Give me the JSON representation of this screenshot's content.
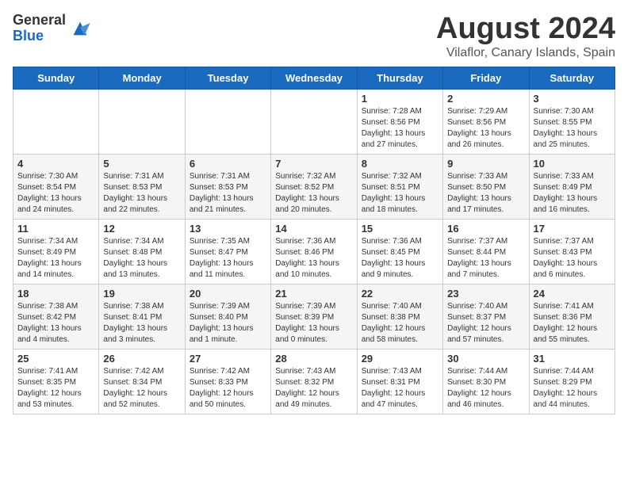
{
  "header": {
    "logo_line1": "General",
    "logo_line2": "Blue",
    "month_title": "August 2024",
    "location": "Vilaflor, Canary Islands, Spain"
  },
  "days_of_week": [
    "Sunday",
    "Monday",
    "Tuesday",
    "Wednesday",
    "Thursday",
    "Friday",
    "Saturday"
  ],
  "weeks": [
    [
      {
        "day": "",
        "info": ""
      },
      {
        "day": "",
        "info": ""
      },
      {
        "day": "",
        "info": ""
      },
      {
        "day": "",
        "info": ""
      },
      {
        "day": "1",
        "info": "Sunrise: 7:28 AM\nSunset: 8:56 PM\nDaylight: 13 hours and 27 minutes."
      },
      {
        "day": "2",
        "info": "Sunrise: 7:29 AM\nSunset: 8:56 PM\nDaylight: 13 hours and 26 minutes."
      },
      {
        "day": "3",
        "info": "Sunrise: 7:30 AM\nSunset: 8:55 PM\nDaylight: 13 hours and 25 minutes."
      }
    ],
    [
      {
        "day": "4",
        "info": "Sunrise: 7:30 AM\nSunset: 8:54 PM\nDaylight: 13 hours and 24 minutes."
      },
      {
        "day": "5",
        "info": "Sunrise: 7:31 AM\nSunset: 8:53 PM\nDaylight: 13 hours and 22 minutes."
      },
      {
        "day": "6",
        "info": "Sunrise: 7:31 AM\nSunset: 8:53 PM\nDaylight: 13 hours and 21 minutes."
      },
      {
        "day": "7",
        "info": "Sunrise: 7:32 AM\nSunset: 8:52 PM\nDaylight: 13 hours and 20 minutes."
      },
      {
        "day": "8",
        "info": "Sunrise: 7:32 AM\nSunset: 8:51 PM\nDaylight: 13 hours and 18 minutes."
      },
      {
        "day": "9",
        "info": "Sunrise: 7:33 AM\nSunset: 8:50 PM\nDaylight: 13 hours and 17 minutes."
      },
      {
        "day": "10",
        "info": "Sunrise: 7:33 AM\nSunset: 8:49 PM\nDaylight: 13 hours and 16 minutes."
      }
    ],
    [
      {
        "day": "11",
        "info": "Sunrise: 7:34 AM\nSunset: 8:49 PM\nDaylight: 13 hours and 14 minutes."
      },
      {
        "day": "12",
        "info": "Sunrise: 7:34 AM\nSunset: 8:48 PM\nDaylight: 13 hours and 13 minutes."
      },
      {
        "day": "13",
        "info": "Sunrise: 7:35 AM\nSunset: 8:47 PM\nDaylight: 13 hours and 11 minutes."
      },
      {
        "day": "14",
        "info": "Sunrise: 7:36 AM\nSunset: 8:46 PM\nDaylight: 13 hours and 10 minutes."
      },
      {
        "day": "15",
        "info": "Sunrise: 7:36 AM\nSunset: 8:45 PM\nDaylight: 13 hours and 9 minutes."
      },
      {
        "day": "16",
        "info": "Sunrise: 7:37 AM\nSunset: 8:44 PM\nDaylight: 13 hours and 7 minutes."
      },
      {
        "day": "17",
        "info": "Sunrise: 7:37 AM\nSunset: 8:43 PM\nDaylight: 13 hours and 6 minutes."
      }
    ],
    [
      {
        "day": "18",
        "info": "Sunrise: 7:38 AM\nSunset: 8:42 PM\nDaylight: 13 hours and 4 minutes."
      },
      {
        "day": "19",
        "info": "Sunrise: 7:38 AM\nSunset: 8:41 PM\nDaylight: 13 hours and 3 minutes."
      },
      {
        "day": "20",
        "info": "Sunrise: 7:39 AM\nSunset: 8:40 PM\nDaylight: 13 hours and 1 minute."
      },
      {
        "day": "21",
        "info": "Sunrise: 7:39 AM\nSunset: 8:39 PM\nDaylight: 13 hours and 0 minutes."
      },
      {
        "day": "22",
        "info": "Sunrise: 7:40 AM\nSunset: 8:38 PM\nDaylight: 12 hours and 58 minutes."
      },
      {
        "day": "23",
        "info": "Sunrise: 7:40 AM\nSunset: 8:37 PM\nDaylight: 12 hours and 57 minutes."
      },
      {
        "day": "24",
        "info": "Sunrise: 7:41 AM\nSunset: 8:36 PM\nDaylight: 12 hours and 55 minutes."
      }
    ],
    [
      {
        "day": "25",
        "info": "Sunrise: 7:41 AM\nSunset: 8:35 PM\nDaylight: 12 hours and 53 minutes."
      },
      {
        "day": "26",
        "info": "Sunrise: 7:42 AM\nSunset: 8:34 PM\nDaylight: 12 hours and 52 minutes."
      },
      {
        "day": "27",
        "info": "Sunrise: 7:42 AM\nSunset: 8:33 PM\nDaylight: 12 hours and 50 minutes."
      },
      {
        "day": "28",
        "info": "Sunrise: 7:43 AM\nSunset: 8:32 PM\nDaylight: 12 hours and 49 minutes."
      },
      {
        "day": "29",
        "info": "Sunrise: 7:43 AM\nSunset: 8:31 PM\nDaylight: 12 hours and 47 minutes."
      },
      {
        "day": "30",
        "info": "Sunrise: 7:44 AM\nSunset: 8:30 PM\nDaylight: 12 hours and 46 minutes."
      },
      {
        "day": "31",
        "info": "Sunrise: 7:44 AM\nSunset: 8:29 PM\nDaylight: 12 hours and 44 minutes."
      }
    ]
  ]
}
